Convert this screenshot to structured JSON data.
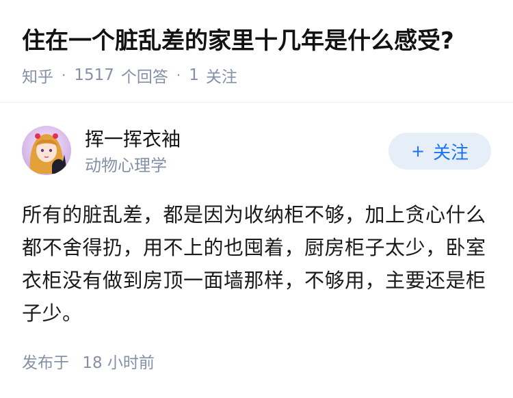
{
  "question": {
    "title": "住在一个脏乱差的家里十几年是什么感受?",
    "source": "知乎",
    "answer_count": "1517",
    "answer_label": "个回答",
    "follow_count": "1",
    "follow_label": "关注",
    "separator": "·"
  },
  "answer": {
    "author_name": "挥一挥衣袖",
    "author_bio": "动物心理学",
    "follow_button_icon": "+",
    "follow_button_label": "关注",
    "content": "所有的脏乱差，都是因为收纳柜不够，加上贪心什么都不舍得扔，用不上的也囤着，厨房柜子太少，卧室衣柜没有做到房顶一面墙那样，不够用，主要还是柜子少。",
    "time_label": "发布于",
    "time_value": "18 小时前"
  },
  "colors": {
    "accent": "#1772f6",
    "follow_bg": "#e6eef8",
    "meta_text": "#8590a6",
    "title_text": "#121212"
  },
  "icons": {
    "avatar": "anime-girl-avatar",
    "plus": "plus-icon"
  }
}
